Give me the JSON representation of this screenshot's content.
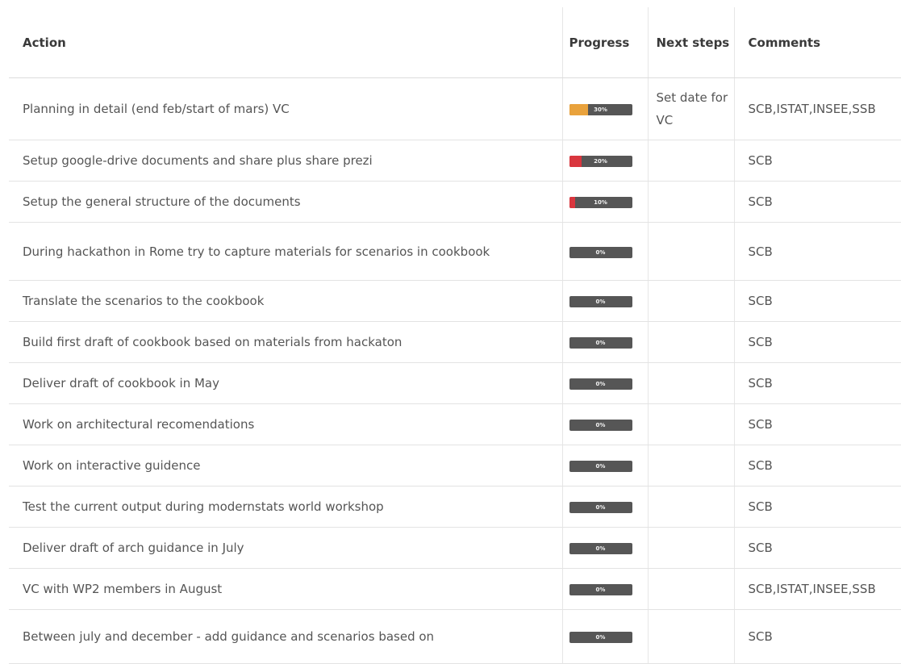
{
  "table": {
    "headers": {
      "action": "Action",
      "progress": "Progress",
      "next_steps": "Next steps",
      "comments": "Comments"
    },
    "rows": [
      {
        "action": "Planning in detail (end feb/start of mars) VC",
        "progress": 0.3,
        "progress_label": "30%",
        "bar_color": "#e9a23c",
        "next_steps": "Set date for VC",
        "comments": "SCB,ISTAT,INSEE,SSB"
      },
      {
        "action": "Setup google-drive documents and share plus share prezi",
        "progress": 0.2,
        "progress_label": "20%",
        "bar_color": "#d9363e",
        "next_steps": "",
        "comments": "SCB"
      },
      {
        "action": "Setup the general structure of the documents",
        "progress": 0.1,
        "progress_label": "10%",
        "bar_color": "#d9363e",
        "next_steps": "",
        "comments": "SCB"
      },
      {
        "action": "During hackathon in Rome try to capture materials for scenarios in cookbook",
        "progress": 0,
        "progress_label": "0%",
        "bar_color": "#d9363e",
        "next_steps": "",
        "comments": "SCB"
      },
      {
        "action": "Translate the scenarios to the cookbook",
        "progress": 0,
        "progress_label": "0%",
        "bar_color": "#d9363e",
        "next_steps": "",
        "comments": "SCB"
      },
      {
        "action": "Build first draft of cookbook based on materials from hackaton",
        "progress": 0,
        "progress_label": "0%",
        "bar_color": "#d9363e",
        "next_steps": "",
        "comments": "SCB"
      },
      {
        "action": "Deliver draft of cookbook in May",
        "progress": 0,
        "progress_label": "0%",
        "bar_color": "#d9363e",
        "next_steps": "",
        "comments": "SCB"
      },
      {
        "action": "Work on architectural recomendations",
        "progress": 0,
        "progress_label": "0%",
        "bar_color": "#d9363e",
        "next_steps": "",
        "comments": "SCB"
      },
      {
        "action": "Work on interactive guidence",
        "progress": 0,
        "progress_label": "0%",
        "bar_color": "#d9363e",
        "next_steps": "",
        "comments": "SCB"
      },
      {
        "action": "Test the current output during modernstats world workshop",
        "progress": 0,
        "progress_label": "0%",
        "bar_color": "#d9363e",
        "next_steps": "",
        "comments": "SCB"
      },
      {
        "action": "Deliver draft of arch guidance in July",
        "progress": 0,
        "progress_label": "0%",
        "bar_color": "#d9363e",
        "next_steps": "",
        "comments": "SCB"
      },
      {
        "action": "VC with WP2 members in August",
        "progress": 0,
        "progress_label": "0%",
        "bar_color": "#d9363e",
        "next_steps": "",
        "comments": "SCB,ISTAT,INSEE,SSB"
      },
      {
        "action": "Between july and december - add guidance and scenarios based on",
        "progress": 0,
        "progress_label": "0%",
        "bar_color": "#d9363e",
        "next_steps": "",
        "comments": "SCB"
      }
    ]
  }
}
